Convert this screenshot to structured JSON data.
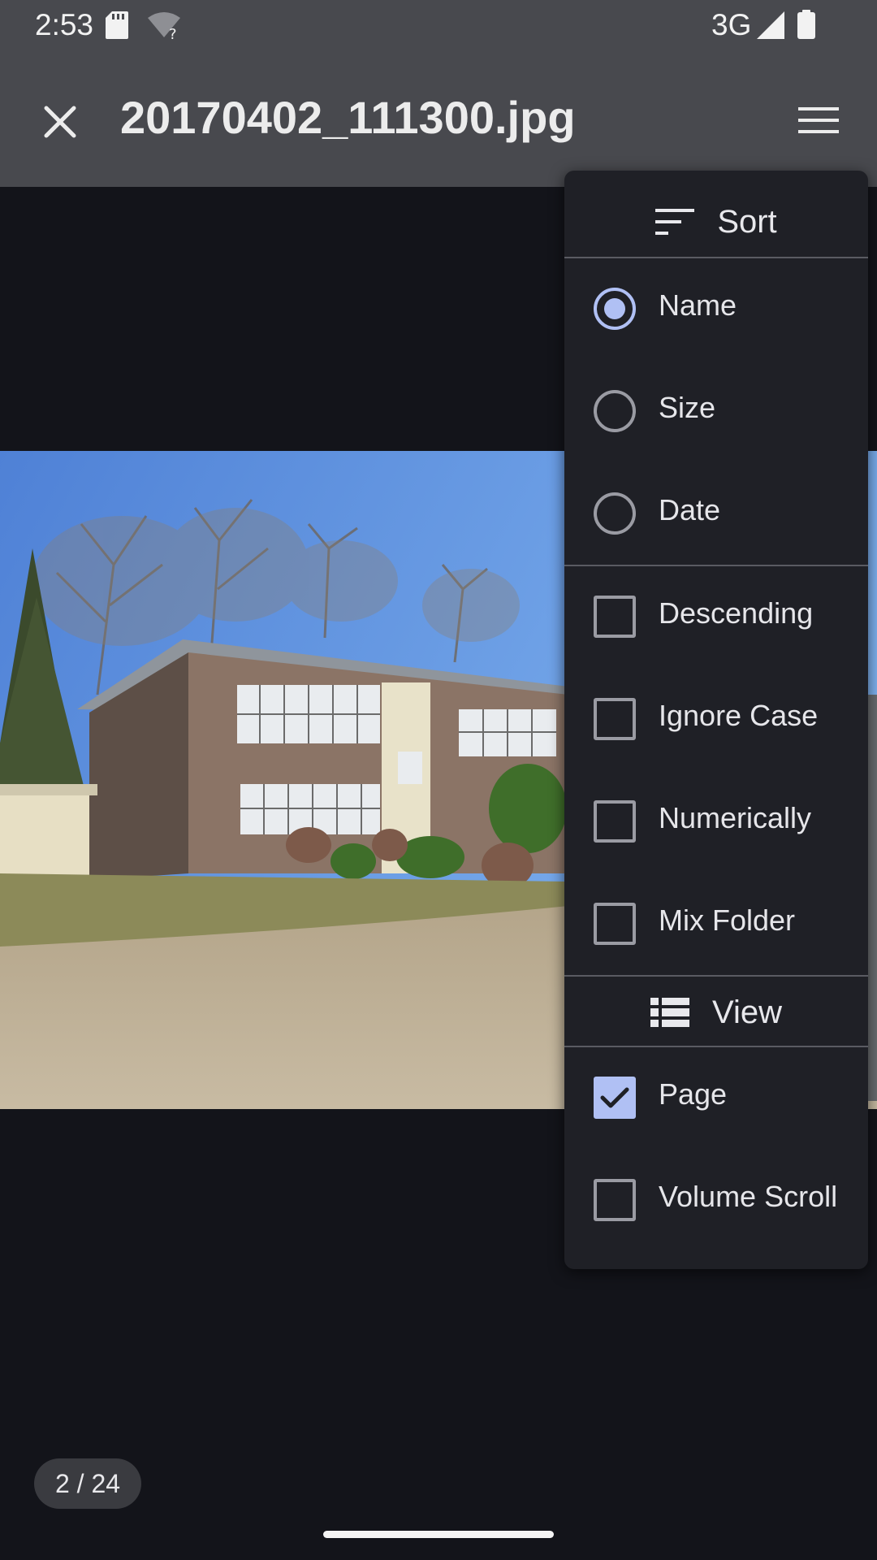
{
  "status_bar": {
    "time": "2:53",
    "network": "3G",
    "icons": [
      "sd-card-icon",
      "wifi-unknown-icon",
      "signal-icon",
      "battery-icon"
    ]
  },
  "app_bar": {
    "title": "20170402_111300.jpg",
    "close_icon": "close-icon",
    "menu_icon": "menu-icon"
  },
  "viewer": {
    "page_counter": "2 / 24"
  },
  "menu": {
    "sort_header": "Sort",
    "sort_options": [
      {
        "label": "Name",
        "selected": true
      },
      {
        "label": "Size",
        "selected": false
      },
      {
        "label": "Date",
        "selected": false
      }
    ],
    "sort_flags": [
      {
        "label": "Descending",
        "checked": false
      },
      {
        "label": "Ignore Case",
        "checked": false
      },
      {
        "label": "Numerically",
        "checked": false
      },
      {
        "label": "Mix Folder",
        "checked": false
      }
    ],
    "view_header": "View",
    "view_options": [
      {
        "label": "Page",
        "checked": true
      },
      {
        "label": "Volume Scroll",
        "checked": false
      }
    ]
  },
  "colors": {
    "app_bar": "#48494e",
    "background": "#13141a",
    "menu_bg": "#1f2026",
    "accent": "#b0c0f4"
  }
}
